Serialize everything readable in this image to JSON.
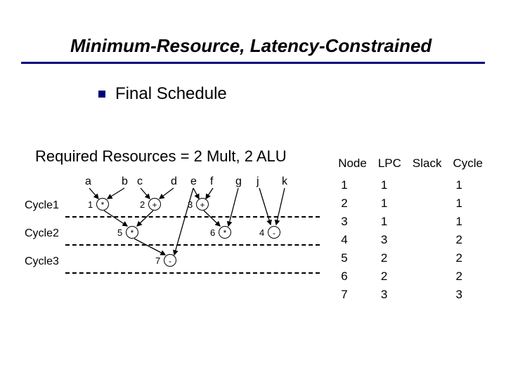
{
  "title": "Minimum-Resource, Latency-Constrained",
  "subtitle": "Final Schedule",
  "required_line": "Required Resources = 2 Mult, 2 ALU",
  "cycle_labels": [
    "Cycle1",
    "Cycle2",
    "Cycle3"
  ],
  "var_labels": [
    "a",
    "b",
    "c",
    "d",
    "e",
    "f",
    "g",
    "j",
    "k"
  ],
  "nodes": {
    "1": "*",
    "2": "+",
    "3": "+",
    "4": "-",
    "5": "*",
    "6": "*",
    "7": "-"
  },
  "node_nums": {
    "1": "1",
    "2": "2",
    "3": "3",
    "4": "4",
    "5": "5",
    "6": "6",
    "7": "7"
  },
  "table": {
    "headers": [
      "Node",
      "LPC",
      "Slack",
      "Cycle"
    ],
    "rows": [
      [
        "1",
        "1",
        "",
        "1"
      ],
      [
        "2",
        "1",
        "",
        "1"
      ],
      [
        "3",
        "1",
        "",
        "1"
      ],
      [
        "4",
        "3",
        "",
        "2"
      ],
      [
        "5",
        "2",
        "",
        "2"
      ],
      [
        "6",
        "2",
        "",
        "2"
      ],
      [
        "7",
        "3",
        "",
        "3"
      ]
    ]
  }
}
